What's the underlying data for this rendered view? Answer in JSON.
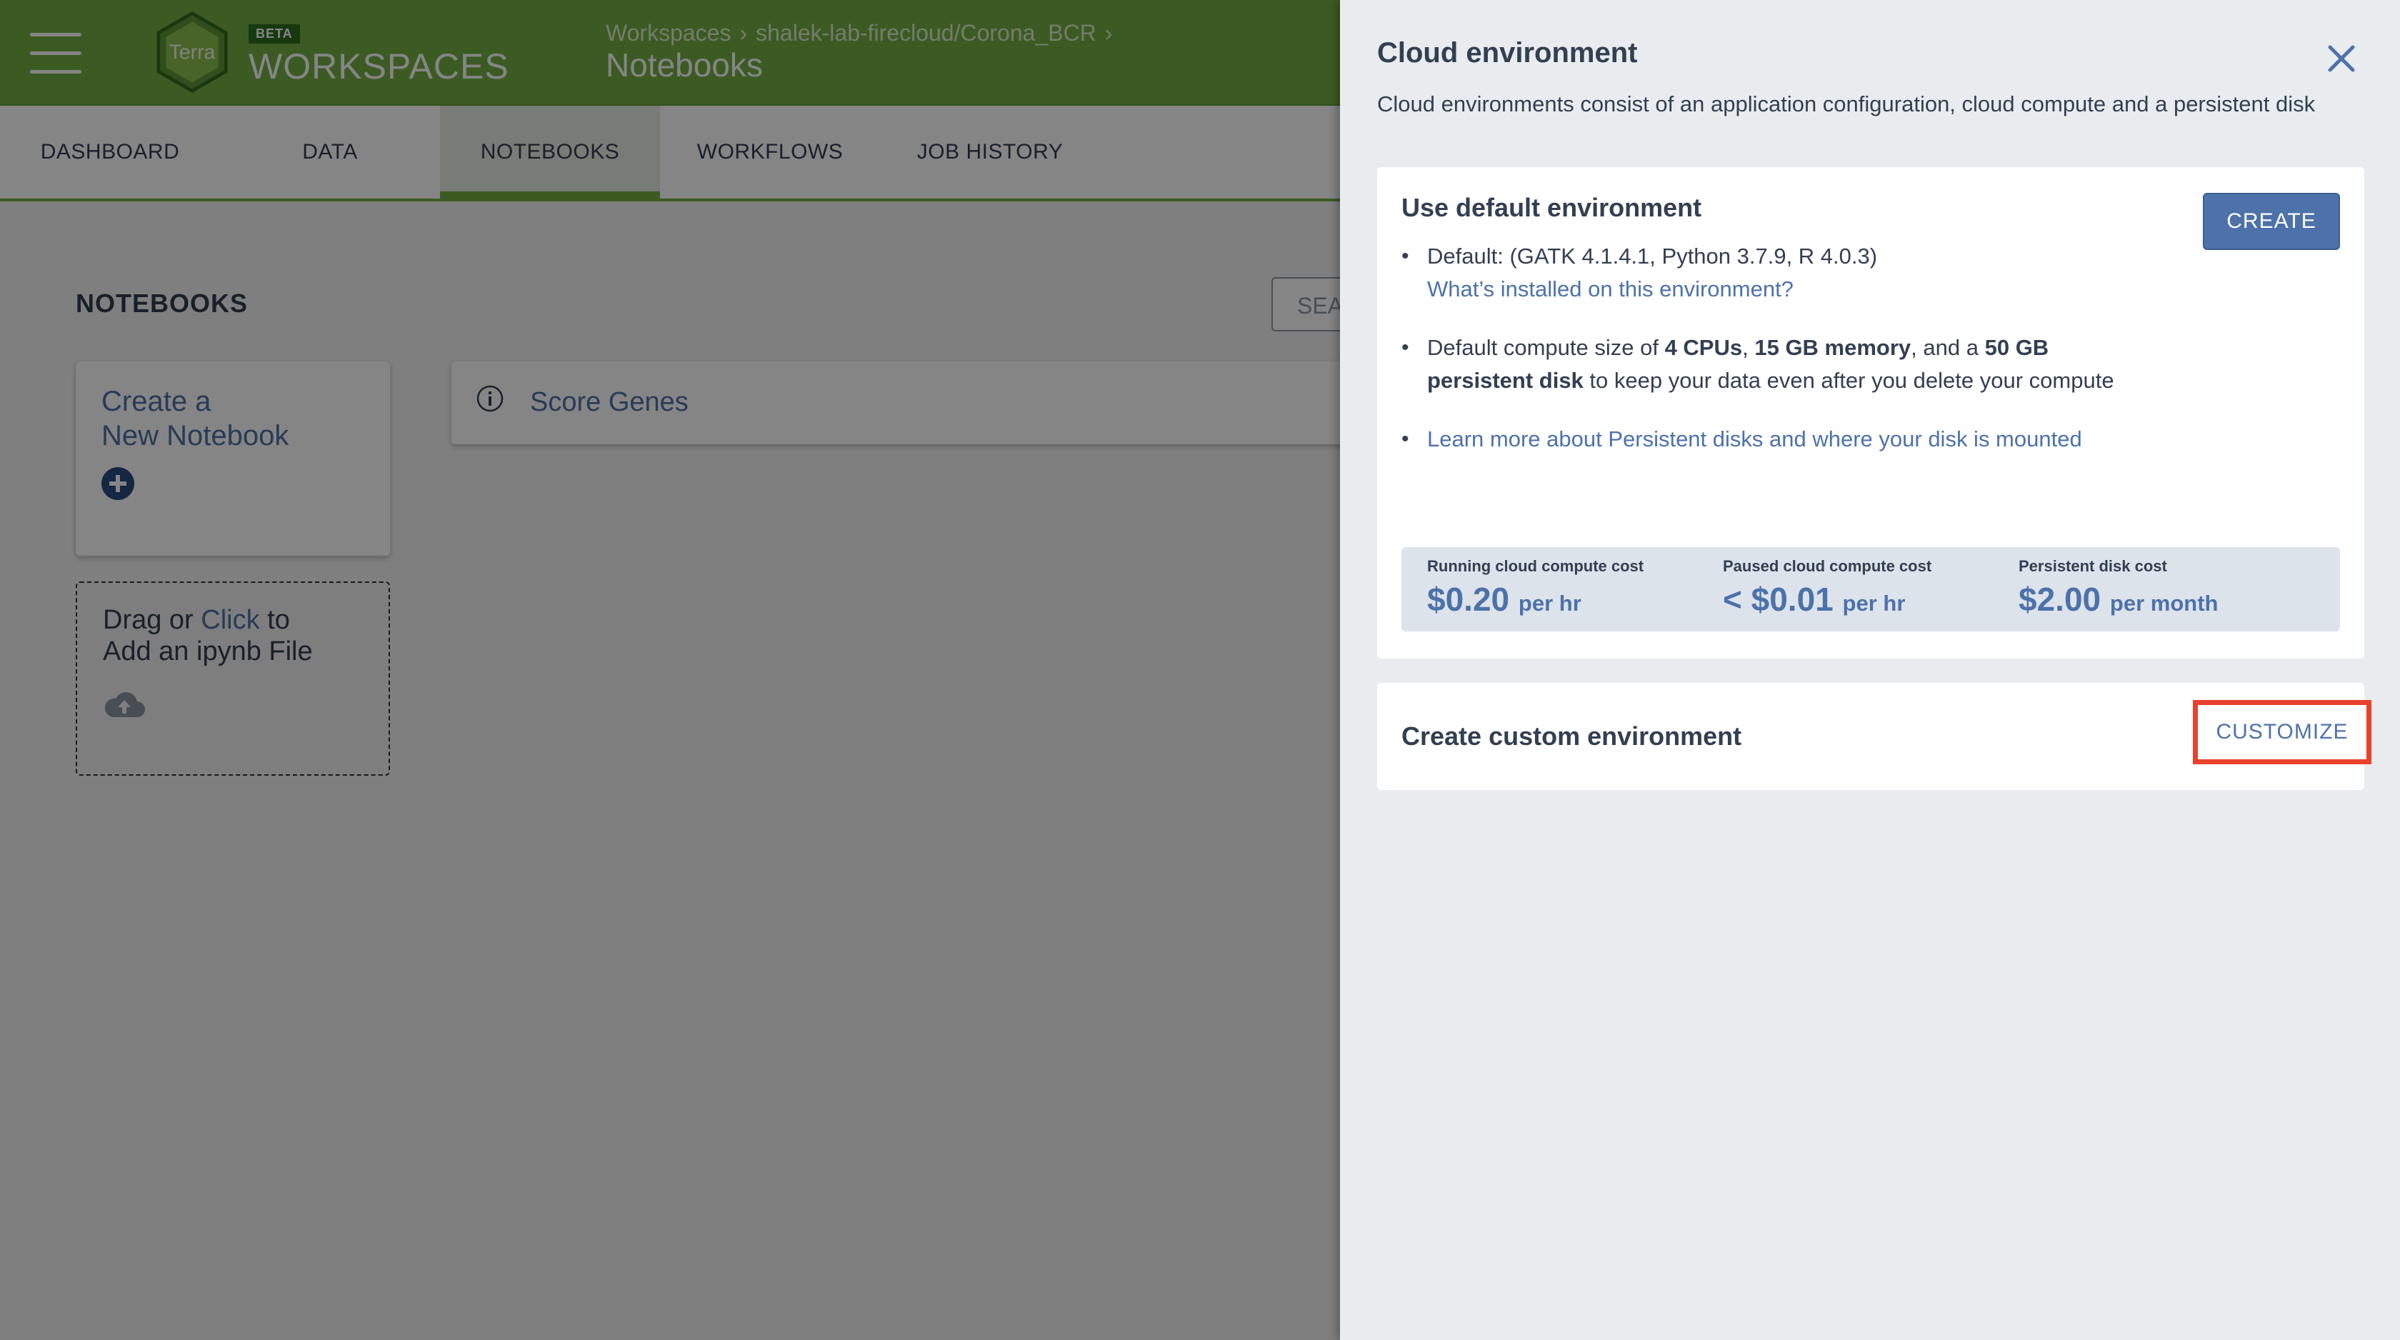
{
  "header": {
    "beta_badge": "BETA",
    "brand": "WORKSPACES",
    "logo_text": "Terra",
    "breadcrumb": [
      "Workspaces",
      "shalek-lab-firecloud/Corona_BCR"
    ],
    "breadcrumb_sep": "›",
    "page_title": "Notebooks"
  },
  "tabs": [
    "DASHBOARD",
    "DATA",
    "NOTEBOOKS",
    "WORKFLOWS",
    "JOB HISTORY"
  ],
  "active_tab": "NOTEBOOKS",
  "main": {
    "section_title": "NOTEBOOKS",
    "search_placeholder": "SEA",
    "create_card": {
      "line1": "Create a",
      "line2": "New Notebook"
    },
    "drop_card": {
      "pre": "Drag or ",
      "link": "Click",
      "post": " to",
      "line2": "Add an ipynb File"
    },
    "notebooks": [
      {
        "name": "Score Genes"
      }
    ]
  },
  "panel": {
    "title": "Cloud environment",
    "description": "Cloud environments consist of an application configuration, cloud compute and a persistent disk",
    "default_section": {
      "title": "Use default environment",
      "create_label": "CREATE",
      "bullet1": "Default: (GATK 4.1.4.1, Python 3.7.9, R 4.0.3)",
      "bullet1_link": "What’s installed on this environment?",
      "bullet2_parts": [
        "Default compute size of ",
        "4 CPUs",
        ", ",
        "15 GB memory",
        ", and a ",
        "50 GB persistent disk",
        " to keep your data even after you delete your compute"
      ],
      "bullet3_link": "Learn more about Persistent disks and where your disk is mounted",
      "costs": [
        {
          "label": "Running cloud compute cost",
          "value": "$0.20",
          "unit": "per hr"
        },
        {
          "label": "Paused cloud compute cost",
          "value": "< $0.01",
          "unit": "per hr"
        },
        {
          "label": "Persistent disk cost",
          "value": "$2.00",
          "unit": "per month"
        }
      ]
    },
    "custom_section": {
      "title": "Create custom environment",
      "customize_label": "CUSTOMIZE"
    }
  },
  "colors": {
    "header_green": "#74ae43",
    "link_blue": "#4d72aa",
    "highlight_red": "#e8422c"
  }
}
